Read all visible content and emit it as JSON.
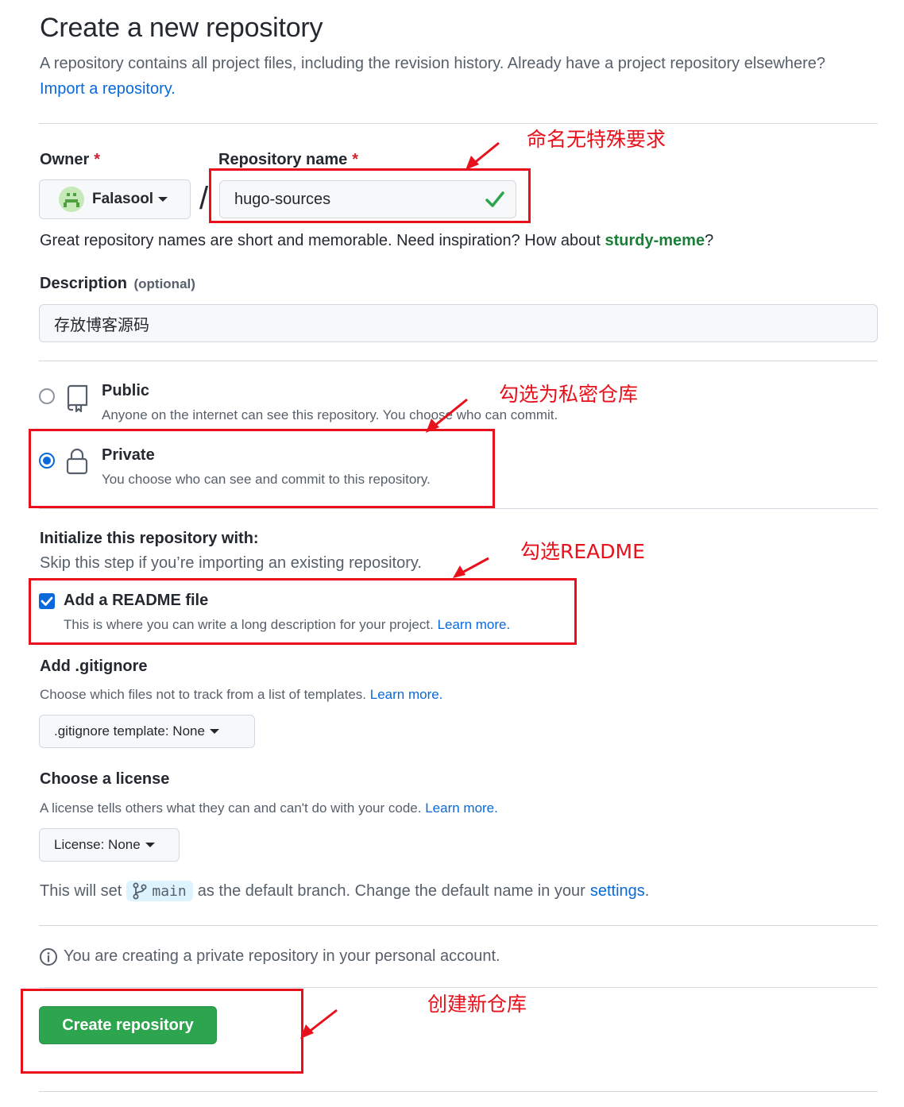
{
  "header": {
    "title": "Create a new repository",
    "lead": "A repository contains all project files, including the revision history. Already have a project repository elsewhere?",
    "import_link": "Import a repository."
  },
  "owner": {
    "label": "Owner",
    "required_mark": "*",
    "value": "Falasool"
  },
  "separator": "/",
  "repo_name": {
    "label": "Repository name",
    "required_mark": "*",
    "value": "hugo-sources"
  },
  "name_hint": {
    "text": "Great repository names are short and memorable. Need inspiration? How about",
    "suggestion": "sturdy-meme",
    "end": "?"
  },
  "description": {
    "label": "Description",
    "optional": "(optional)",
    "value": "存放博客源码"
  },
  "visibility": {
    "public_title": "Public",
    "public_desc": "Anyone on the internet can see this repository. You choose who can commit.",
    "private_title": "Private",
    "private_desc": "You choose who can see and commit to this repository.",
    "selected": "private"
  },
  "init": {
    "title": "Initialize this repository with:",
    "subtitle": "Skip this step if you’re importing an existing repository.",
    "readme_label": "Add a README file",
    "readme_desc": "This is where you can write a long description for your project.",
    "readme_learn": "Learn more.",
    "readme_checked": true
  },
  "gitignore": {
    "title": "Add .gitignore",
    "desc": "Choose which files not to track from a list of templates.",
    "learn": "Learn more.",
    "select_label": ".gitignore template: None"
  },
  "license": {
    "title": "Choose a license",
    "desc": "A license tells others what they can and can't do with your code.",
    "learn": "Learn more.",
    "select_label": "License: None"
  },
  "branch": {
    "prefix": "This will set",
    "name": "main",
    "suffix": "as the default branch. Change the default name in your",
    "settings_link": "settings",
    "end": "."
  },
  "info_note": "You are creating a private repository in your personal account.",
  "create_button": "Create repository",
  "annotations": {
    "name": "命名无特殊要求",
    "private": "勾选为私密仓库",
    "readme": "勾选README",
    "create": "创建新仓库"
  },
  "colors": {
    "accent": "#0969da",
    "success": "#2da44e",
    "annotation_red": "#e8101b"
  }
}
